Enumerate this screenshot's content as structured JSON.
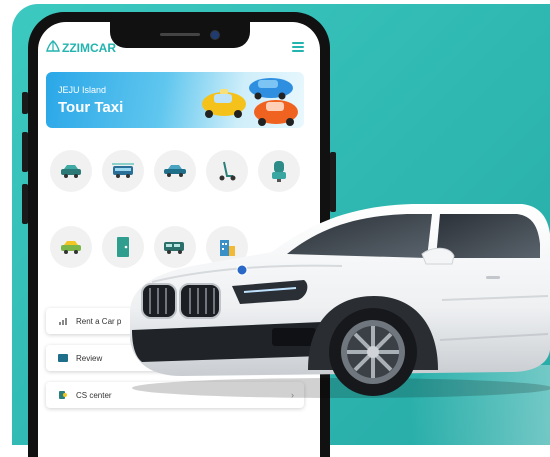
{
  "app": {
    "brand": "ZZIMCAR",
    "colors": {
      "teal": "#2fb8b2",
      "accent": "#23b4b0",
      "banner_blue": "#2aa7e8"
    }
  },
  "banner": {
    "subtitle": "JEJU Island",
    "title": "Tour Taxi"
  },
  "categories": [
    {
      "icon": "car-icon"
    },
    {
      "icon": "bus-shuttle-icon"
    },
    {
      "icon": "sedan-icon"
    },
    {
      "icon": "scooter-icon"
    },
    {
      "icon": "seat-icon"
    },
    {
      "icon": "taxi-icon"
    },
    {
      "icon": "door-icon"
    },
    {
      "icon": "van-icon"
    },
    {
      "icon": "building-icon"
    }
  ],
  "menu": [
    {
      "label": "Rent a Car p",
      "icon": "chart-icon"
    },
    {
      "label": "Review",
      "icon": "card-icon"
    },
    {
      "label": "CS center",
      "icon": "support-icon"
    }
  ]
}
